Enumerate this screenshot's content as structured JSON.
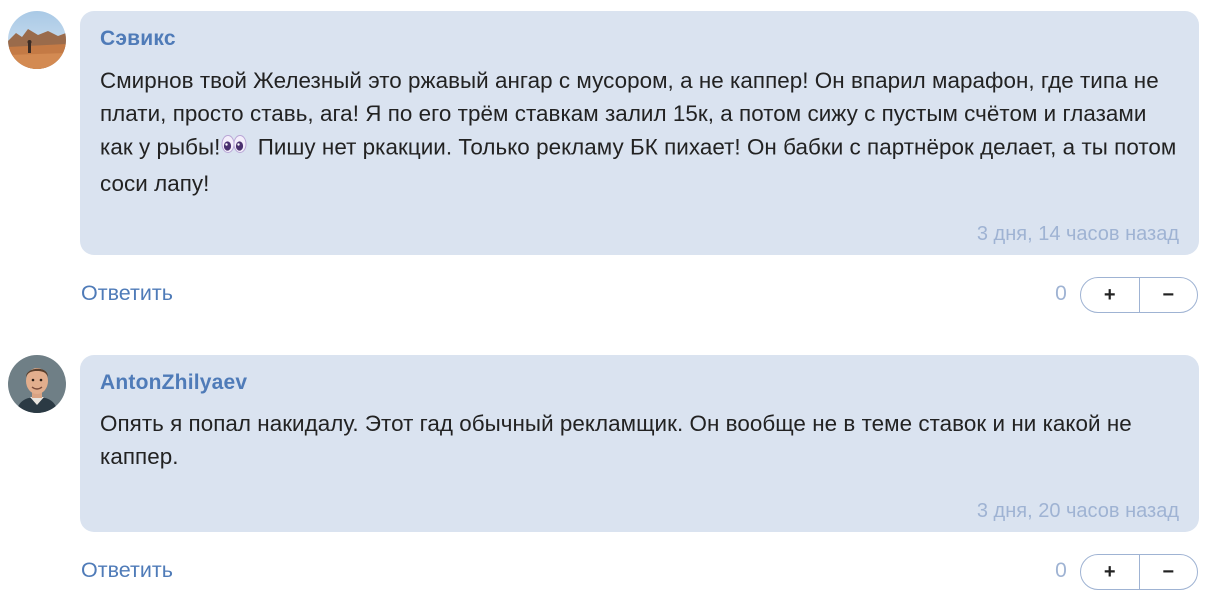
{
  "comments": [
    {
      "author": "Сэвикс",
      "avatar_icon": "desert-landscape-avatar",
      "text_before_emoji": "Смирнов твой Железный это ржавый ангар с мусором, а не каппер! Он впарил марафон, где типа не плати, просто ставь, ага! Я по его трём ставкам залил 15к, а потом сижу с пустым счётом и глазами как у рыбы!",
      "emoji_icon": "eyes-emoji",
      "text_after_emoji": " Пишу нет ркакции. Только рекламу БК пихает! Он бабки с партнёрок делает, а ты потом соси лапу!",
      "time": "3 дня, 14 часов назад",
      "reply_label": "Ответить",
      "score": "0",
      "plus_label": "+",
      "minus_label": "−"
    },
    {
      "author": "AntonZhilyaev",
      "avatar_icon": "man-portrait-avatar",
      "text": "Опять я попал накидалу. Этот гад обычный рекламщик. Он вообще не в теме ставок и ни какой не каппер.",
      "time": "3 дня, 20 часов назад",
      "reply_label": "Ответить",
      "score": "0",
      "plus_label": "+",
      "minus_label": "−"
    }
  ],
  "colors": {
    "bubble": "#dae3f0",
    "author": "#4f7bb8",
    "link": "#4f7bb8",
    "muted": "#9fb3d3",
    "text": "#222222"
  }
}
